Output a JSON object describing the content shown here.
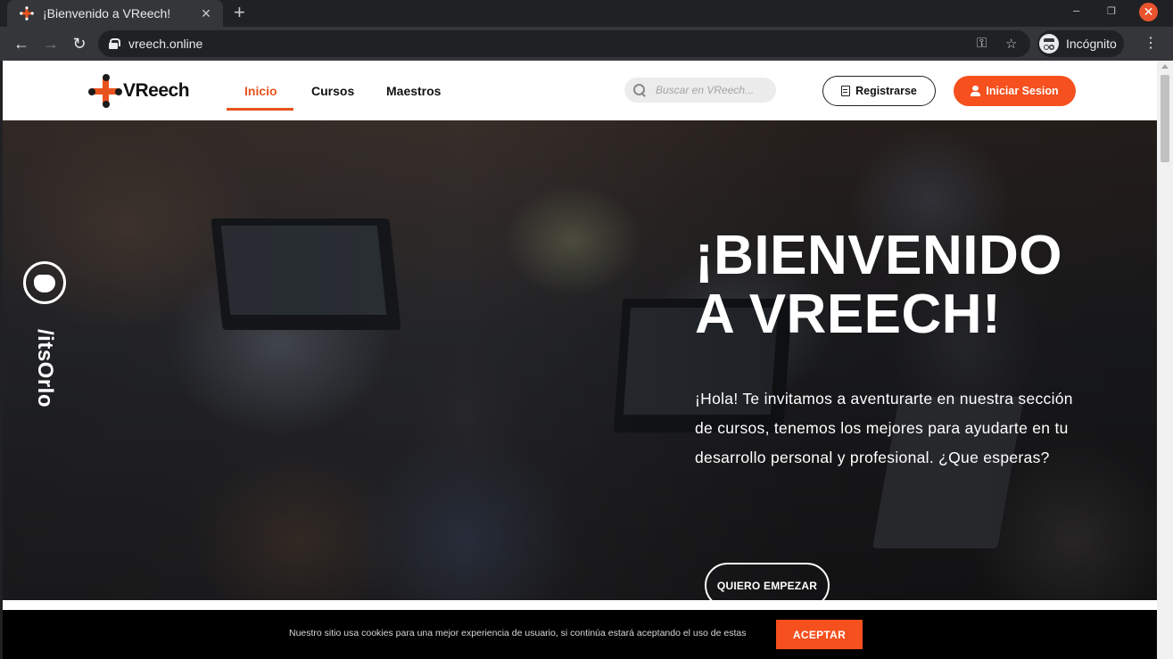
{
  "browser": {
    "tab_title": "¡Bienvenido a VReech!",
    "tab_close": "✕",
    "new_tab": "+",
    "url": "vreech.online",
    "profile_label": "Incógnito",
    "minimize": "–",
    "restore": "❐",
    "close": "✕",
    "back": "←",
    "forward": "→",
    "reload": "↻",
    "key_icon": "⚿",
    "star_icon": "☆",
    "menu": "⋮"
  },
  "site": {
    "logo_text": "VReech",
    "nav": [
      {
        "label": "Inicio",
        "active": true
      },
      {
        "label": "Cursos",
        "active": false
      },
      {
        "label": "Maestros",
        "active": false
      }
    ],
    "search": {
      "placeholder": "Buscar en VReech..."
    },
    "register_label": "Registrarse",
    "login_label": "Iniciar Sesion",
    "accent_color": "#f5501e"
  },
  "hero": {
    "watermark": "/itsOrlo",
    "title": "¡BIENVENIDO A VREECH!",
    "text": "¡Hola! Te invitamos a aventurarte en nuestra sección de cursos, tenemos los mejores para ayudarte en tu desarrollo personal y profesional. ¿Que esperas?",
    "cta_label": "QUIERO EMPEZAR"
  },
  "cookies": {
    "text": "Nuestro sitio usa cookies para una mejor experiencia de usuario, si continúa estará aceptando el uso de estas",
    "accept_label": "ACEPTAR"
  }
}
